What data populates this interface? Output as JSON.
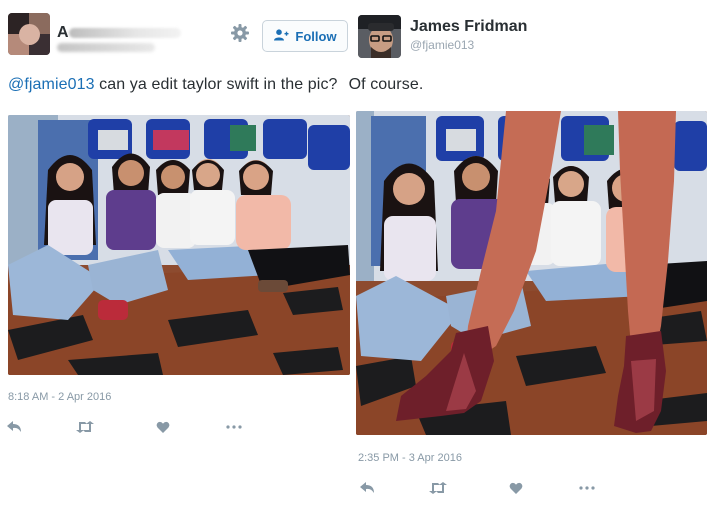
{
  "left_tweet": {
    "name_initial": "A",
    "follow_label": "Follow",
    "timestamp": "8:18 AM - 2 Apr 2016"
  },
  "right_tweet": {
    "name": "James Fridman",
    "handle": "@fjamie013",
    "timestamp": "2:35 PM - 3 Apr 2016"
  },
  "tweet_text": {
    "mention": "@fjamie013",
    "question": " can ya edit taylor swift in the pic?",
    "reply": "Of course."
  },
  "icons": {
    "settings": "gear-icon",
    "follow": "add-user-icon",
    "reply": "reply-icon",
    "retweet": "retweet-icon",
    "like": "heart-icon",
    "more": "more-icon"
  },
  "colors": {
    "accent": "#1b6fb5",
    "text": "#292f33",
    "muted": "#8899a6"
  }
}
